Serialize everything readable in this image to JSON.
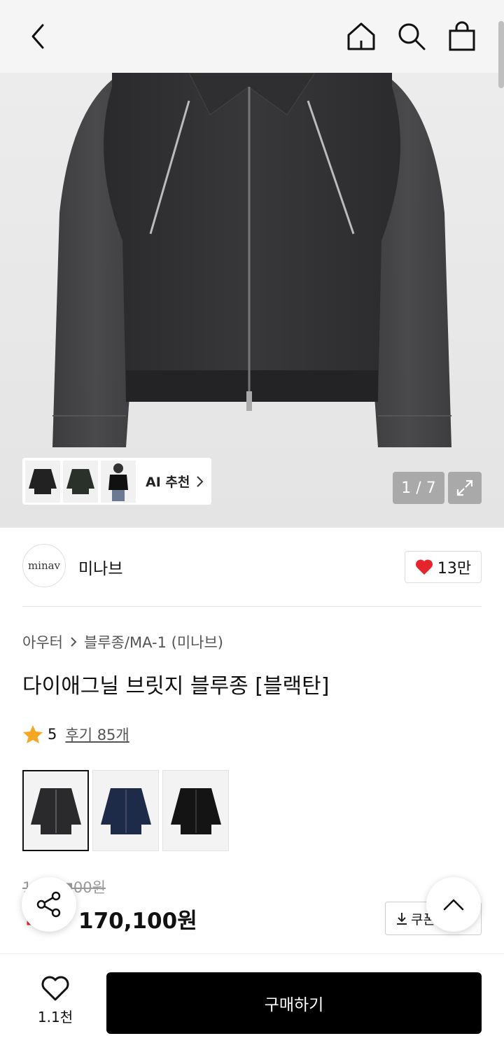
{
  "header": {
    "back_icon": "chevron-left-icon",
    "home_icon": "home-icon",
    "search_icon": "search-icon",
    "cart_icon": "shopping-bag-icon"
  },
  "gallery": {
    "pager": "1 / 7",
    "ai_label": "AI 추천",
    "expand_icon": "expand-icon"
  },
  "brand": {
    "logo_text": "minav",
    "name": "미나브",
    "likes": "13만"
  },
  "product": {
    "breadcrumb": [
      "아우터",
      "블루종/MA-1 (미나브)"
    ],
    "title": "다이애그닐 브릿지 블루종 [블랙탄]",
    "rating": "5",
    "reviews": "후기 85개",
    "colors": [
      "블랙탄",
      "네이비",
      "블랙"
    ],
    "original_price": "1■■■00원",
    "discount": "■■",
    "price": "170,100원",
    "coupon_label": "쿠폰"
  },
  "bottom": {
    "wish_count": "1.1천",
    "buy_label": "구매하기"
  },
  "colors_hex": {
    "accent_red": "#e5242b",
    "star": "#f5a623",
    "buy_bg": "#000000"
  }
}
